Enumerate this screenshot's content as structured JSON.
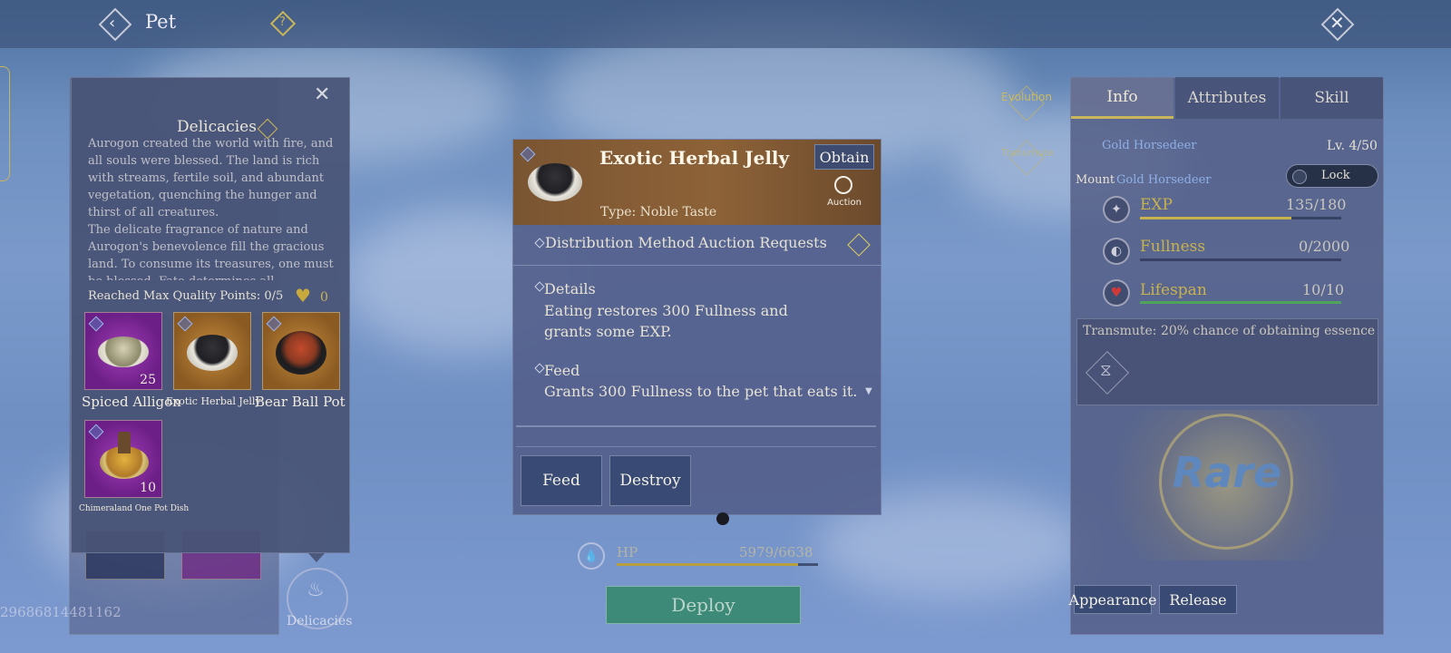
{
  "header": {
    "title": "Pet"
  },
  "left_overlay": {
    "id_number": "29686814481162",
    "delicacies_label": "Delicacies"
  },
  "delicacies_panel": {
    "title": "Delicacies",
    "description": "Aurogon created the world with fire, and all souls were blessed. The land is rich with streams, fertile soil, and abundant vegetation, quenching the hunger and thirst of all creatures.\nThe delicate fragrance of nature and Aurogon's benevolence fill the gracious land. To consume its treasures, one must be blessed. Fate determines all.",
    "quality_points": "Reached Max Quality Points: 0/5",
    "heart_count": "0",
    "items": [
      {
        "name": "Spiced Alligon",
        "qty": "25"
      },
      {
        "name": "Exotic Herbal Jelly",
        "qty": ""
      },
      {
        "name": "Bear Ball Pot",
        "qty": ""
      },
      {
        "name": "Chimeraland One Pot Dish",
        "qty": "10"
      }
    ]
  },
  "item_detail": {
    "name": "Exotic Herbal Jelly",
    "obtain_label": "Obtain",
    "auction_label": "Auction",
    "type": "Type: Noble Taste",
    "distribution_label": "Distribution Method",
    "distribution_value": "Auction Requests",
    "details_title": "Details",
    "details_text": "Eating restores 300 Fullness and grants some EXP.",
    "feed_title": "Feed",
    "feed_text": "Grants 300 Fullness to the pet that eats it.",
    "feed_button": "Feed",
    "destroy_button": "Destroy"
  },
  "center": {
    "hp_label": "HP",
    "hp_value": "5979/6638",
    "hp_fraction": 0.9,
    "deploy_button": "Deploy"
  },
  "side_labels": {
    "evolution": "Evolution",
    "transmute": "Transmute"
  },
  "info_panel": {
    "tabs": [
      "Info",
      "Attributes",
      "Skill"
    ],
    "pet_name": "Gold Horsedeer",
    "level": "Lv. 4/50",
    "mount_label": "Mount",
    "mount_name": "Gold Horsedeer",
    "lock_label": "Lock",
    "stats": [
      {
        "label": "EXP",
        "value": "135/180",
        "fraction": 0.75,
        "color": "#c8b24e"
      },
      {
        "label": "Fullness",
        "value": "0/2000",
        "fraction": 0.0,
        "color": "#c8b24e"
      },
      {
        "label": "Lifespan",
        "value": "10/10",
        "fraction": 1.0,
        "color": "#4fa35a"
      }
    ],
    "transmute_text": "Transmute: 20% chance of obtaining essence",
    "rarity": "Rare",
    "appearance_button": "Appearance",
    "release_button": "Release"
  }
}
